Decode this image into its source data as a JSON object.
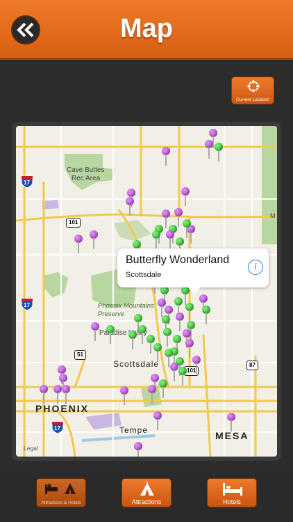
{
  "navbar": {
    "title": "Map",
    "back_icon": "double-chevron-left-icon"
  },
  "current_location": {
    "label": "Current Location",
    "icon": "crosshair-icon"
  },
  "map": {
    "labels": {
      "cave_buttes": "Cave Buttes",
      "rec_area": "Rec Area",
      "phoenix_mountains": "Phoenix Mountains",
      "preserve": "Preserve",
      "paradise_valley": "Paradise Valley",
      "scottsdale": "Scottsdale",
      "phoenix": "PHOENIX",
      "tempe": "Tempe",
      "mesa": "MESA",
      "m": "M"
    },
    "shields": {
      "i17_top": "17",
      "i17_mid": "17",
      "i17_bottom": "17",
      "us101_top": "101",
      "us101_bottom": "101",
      "sr51": "51",
      "sr87": "87"
    },
    "legal": "Legal",
    "pin_colors": {
      "purple": "#b341d6",
      "green": "#2eb32a"
    }
  },
  "callout": {
    "title": "Butterfly Wonderland",
    "subtitle": "Scottsdale",
    "info_icon": "info-icon"
  },
  "tabs": [
    {
      "label": "Attractions & Hotels",
      "icon": "tent-bed-icon"
    },
    {
      "label": "Attractions",
      "icon": "tent-icon"
    },
    {
      "label": "Hotels",
      "icon": "bed-icon"
    }
  ],
  "colors": {
    "accent": "#e56a1c",
    "background": "#2a2a2a",
    "map_bg": "#f2efe6",
    "road": "#f2c84f",
    "park": "#b8d6a0"
  }
}
